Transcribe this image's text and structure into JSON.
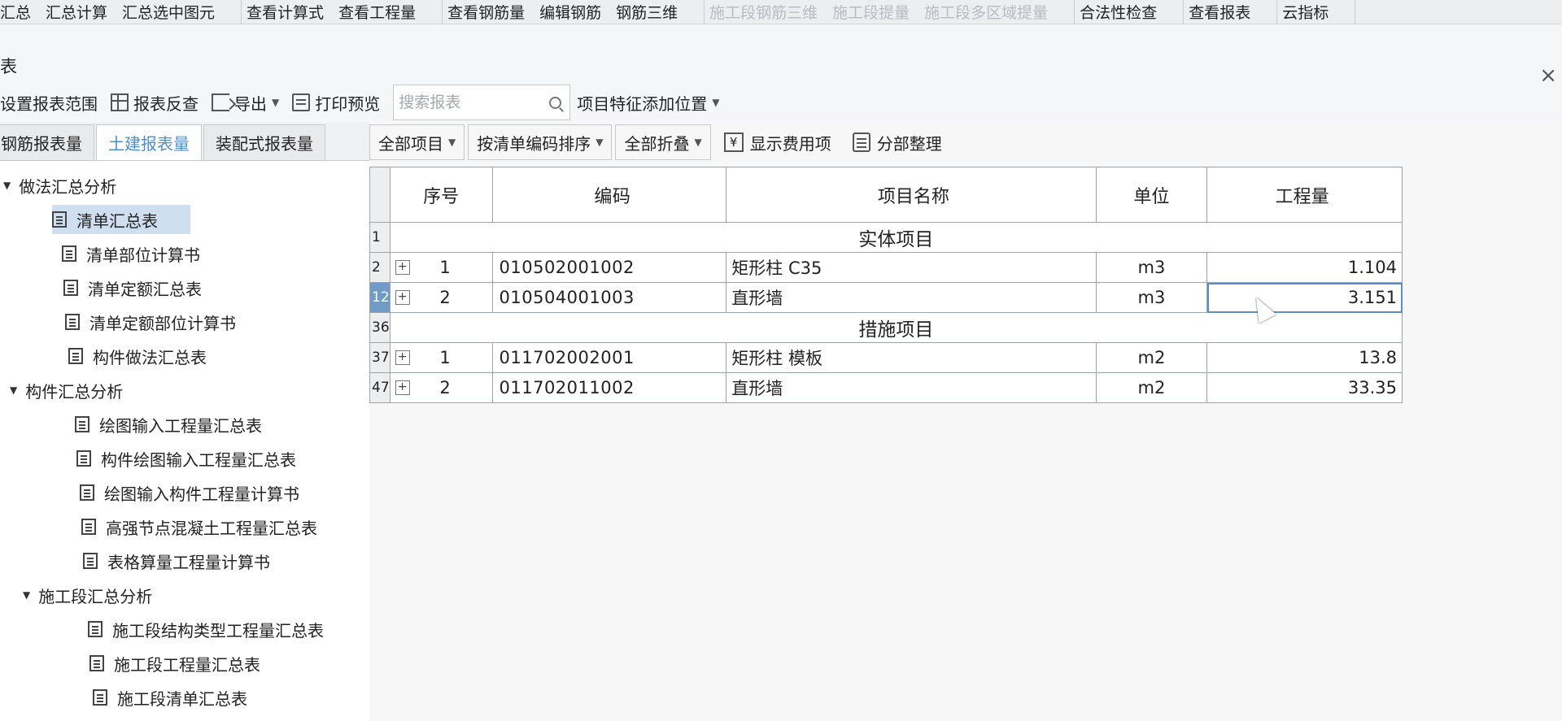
{
  "ribbon": {
    "groups": [
      {
        "items": [
          {
            "label": "汇总",
            "dim": false
          },
          {
            "label": "汇总计算",
            "dim": false
          },
          {
            "label": "汇总选中图元",
            "dim": false
          }
        ]
      },
      {
        "items": [
          {
            "label": "查看计算式",
            "dim": false
          },
          {
            "label": "查看工程量",
            "dim": false
          }
        ]
      },
      {
        "items": [
          {
            "label": "查看钢筋量",
            "dim": false
          },
          {
            "label": "编辑钢筋",
            "dim": false
          },
          {
            "label": "钢筋三维",
            "dim": false
          }
        ]
      },
      {
        "items": [
          {
            "label": "施工段钢筋三维",
            "dim": true
          },
          {
            "label": "施工段提量",
            "dim": true
          },
          {
            "label": "施工段多区域提量",
            "dim": true
          }
        ]
      },
      {
        "items": [
          {
            "label": "合法性检查",
            "dim": false
          }
        ]
      },
      {
        "items": [
          {
            "label": "查看报表",
            "dim": false
          }
        ]
      },
      {
        "items": [
          {
            "label": "云指标",
            "dim": false
          }
        ]
      }
    ]
  },
  "window": {
    "title": "表",
    "close_label": "×"
  },
  "toolbar": {
    "set_range": "设置报表范围",
    "reverse_check": "报表反查",
    "export": "导出",
    "print_preview": "打印预览",
    "search_placeholder": "搜索报表",
    "feature_position": "项目特征添加位置"
  },
  "left_tabs": [
    "钢筋报表量",
    "土建报表量",
    "装配式报表量"
  ],
  "tree": {
    "groups": [
      {
        "label": "做法汇总分析",
        "items": [
          "清单汇总表",
          "清单部位计算书",
          "清单定额汇总表",
          "清单定额部位计算书",
          "构件做法汇总表"
        ]
      },
      {
        "label": "构件汇总分析",
        "items": [
          "绘图输入工程量汇总表",
          "构件绘图输入工程量汇总表",
          "绘图输入构件工程量计算书",
          "高强节点混凝土工程量汇总表",
          "表格算量工程量计算书"
        ]
      },
      {
        "label": "施工段汇总分析",
        "items": [
          "施工段结构类型工程量汇总表",
          "施工段工程量汇总表",
          "施工段清单汇总表"
        ]
      }
    ],
    "selected": "清单汇总表"
  },
  "report_toolbar": {
    "all_items": "全部项目",
    "sort_by_code": "按清单编码排序",
    "collapse_all": "全部折叠",
    "yen_glyph": "¥",
    "show_fees": "显示费用项",
    "arrange": "分部整理"
  },
  "table": {
    "headers": {
      "seq": "序号",
      "code": "编码",
      "name": "项目名称",
      "unit": "单位",
      "qty": "工程量"
    },
    "sections": [
      {
        "row_no": "1",
        "label": "实体项目",
        "rows": [
          {
            "row_no": "2",
            "seq": "1",
            "code": "010502001002",
            "name": "矩形柱 C35",
            "unit": "m3",
            "qty": "1.104"
          },
          {
            "row_no": "12",
            "seq": "2",
            "code": "010504001003",
            "name": "直形墙",
            "unit": "m3",
            "qty": "3.151"
          }
        ]
      },
      {
        "row_no": "36",
        "label": "措施项目",
        "rows": [
          {
            "row_no": "37",
            "seq": "1",
            "code": "011702002001",
            "name": "矩形柱 模板",
            "unit": "m2",
            "qty": "13.8"
          },
          {
            "row_no": "47",
            "seq": "2",
            "code": "011702011002",
            "name": "直形墙",
            "unit": "m2",
            "qty": "33.35"
          }
        ]
      }
    ],
    "expand_glyph": "+"
  }
}
